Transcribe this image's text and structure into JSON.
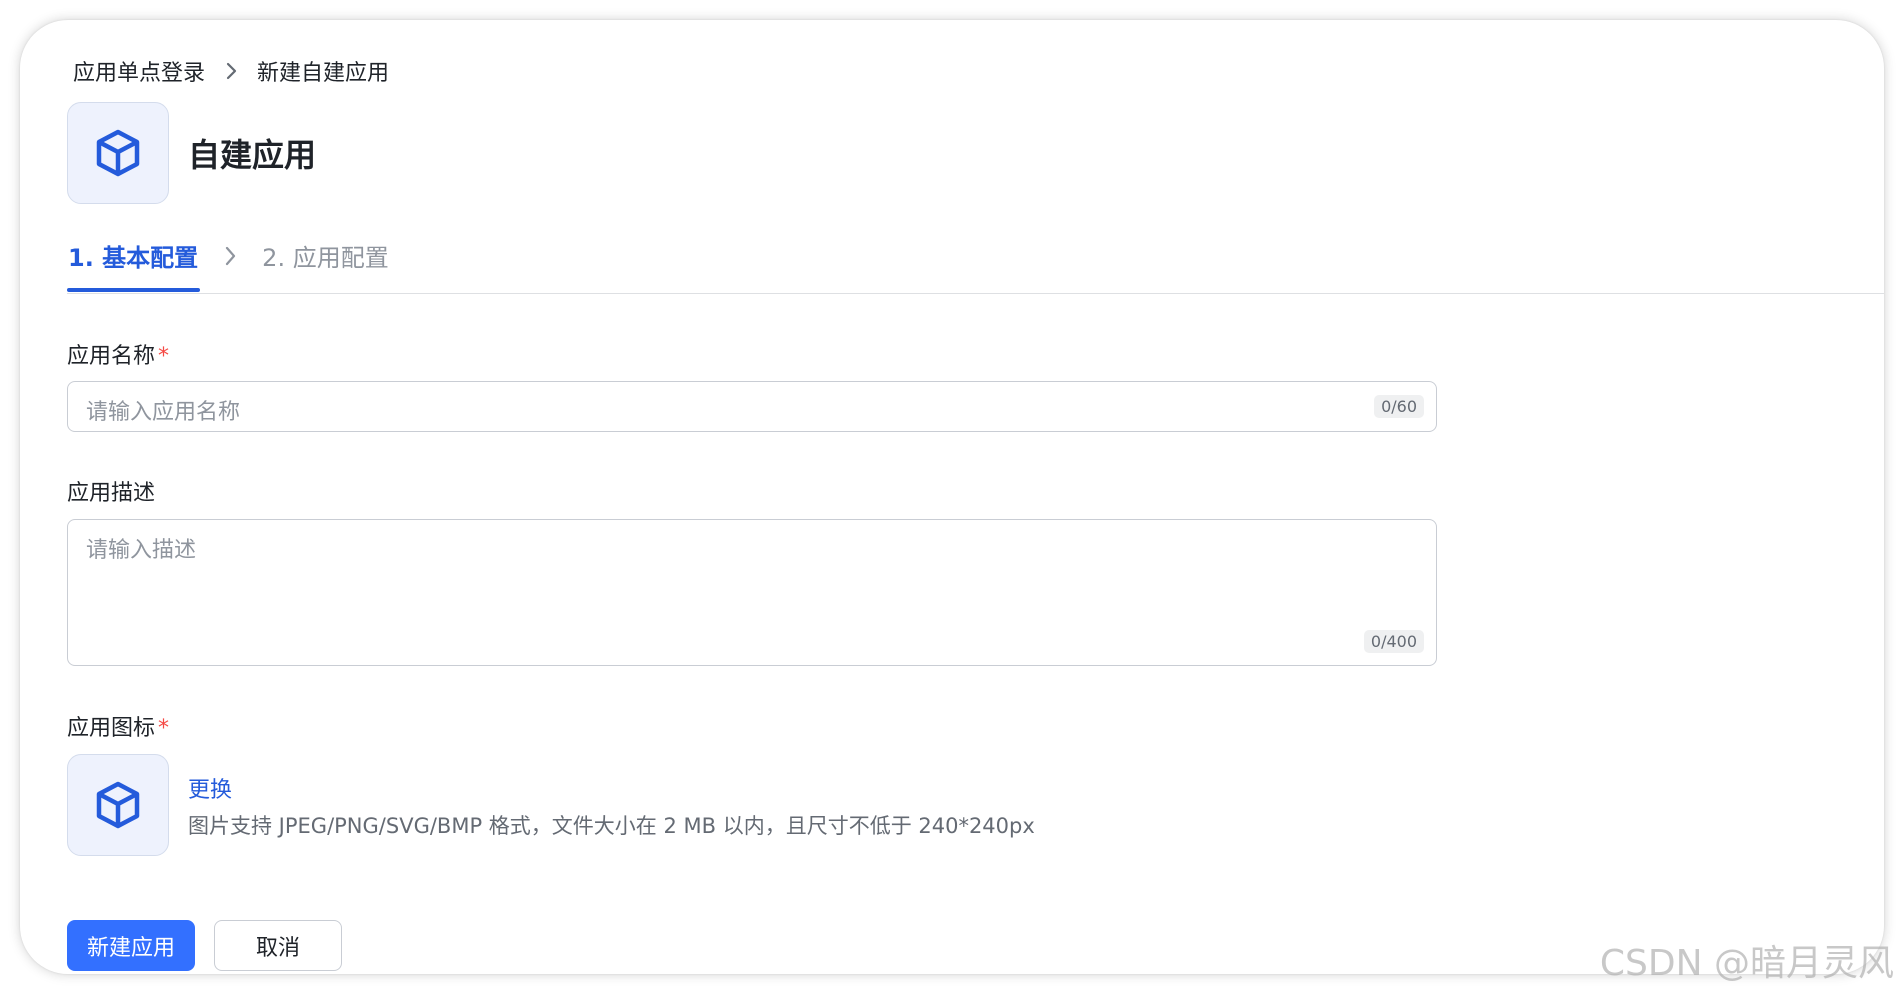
{
  "breadcrumb": {
    "parent": "应用单点登录",
    "current": "新建自建应用"
  },
  "header": {
    "title": "自建应用",
    "logo_icon": "cube-icon"
  },
  "steps": [
    {
      "label": "1. 基本配置",
      "active": true
    },
    {
      "label": "2. 应用配置",
      "active": false
    }
  ],
  "form": {
    "name": {
      "label": "应用名称",
      "required_mark": "*",
      "placeholder": "请输入应用名称",
      "counter": "0/60"
    },
    "description": {
      "label": "应用描述",
      "placeholder": "请输入描述",
      "counter": "0/400"
    },
    "icon": {
      "label": "应用图标",
      "required_mark": "*",
      "change_label": "更换",
      "hint": "图片支持 JPEG/PNG/SVG/BMP 格式，文件大小在 2 MB 以内，且尺寸不低于 240*240px",
      "preview_icon": "cube-icon"
    }
  },
  "actions": {
    "create_label": "新建应用",
    "cancel_label": "取消"
  },
  "colors": {
    "primary": "#3370ff",
    "link": "#245bdb",
    "required": "#f54a45",
    "icon_bg": "#eef2fd"
  },
  "watermark": "CSDN @暗月灵风"
}
